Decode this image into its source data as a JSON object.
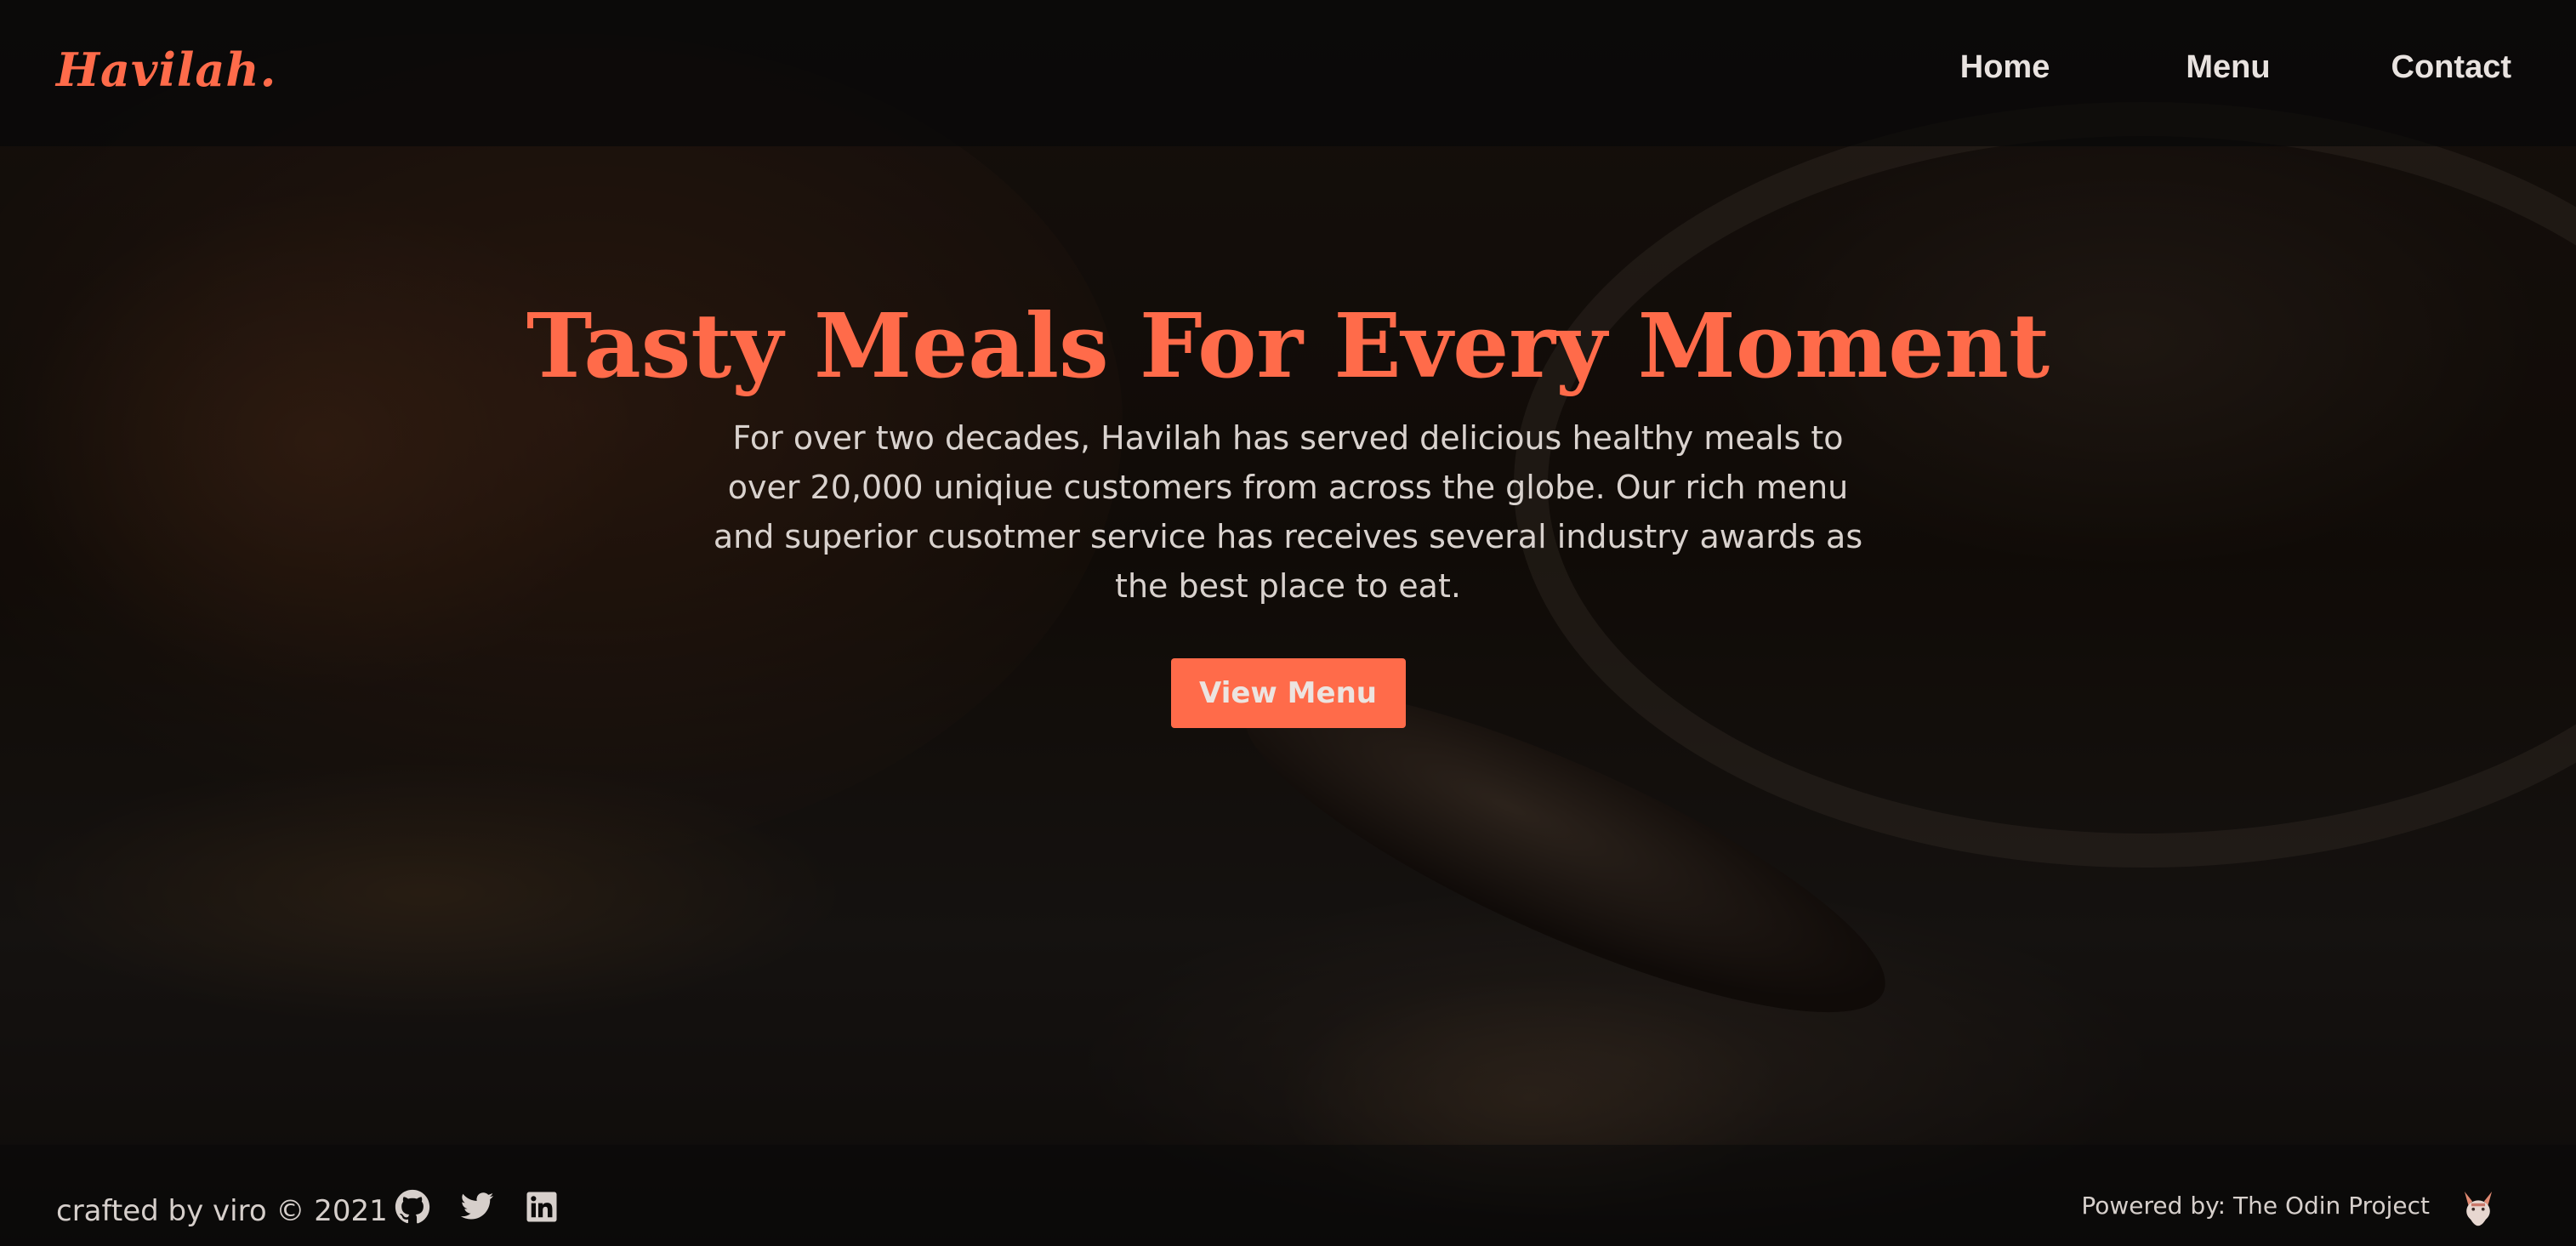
{
  "header": {
    "logo": "Havilah.",
    "nav": [
      {
        "label": "Home"
      },
      {
        "label": "Menu"
      },
      {
        "label": "Contact"
      }
    ]
  },
  "hero": {
    "title": "Tasty Meals For Every Moment",
    "description": "For over two decades, Havilah has served delicious healthy meals to over 20,000 uniqiue customers from across the globe. Our rich menu and superior cusotmer service has receives several industry awards as the best place to eat.",
    "button_label": "View Menu"
  },
  "footer": {
    "credit": "crafted by viro © 2021",
    "socials": [
      {
        "icon": "github-icon"
      },
      {
        "icon": "twitter-icon"
      },
      {
        "icon": "linkedin-icon"
      }
    ],
    "powered_by": "Powered by: The Odin Project",
    "powered_icon": "odin-project-icon"
  },
  "colors": {
    "accent": "#ff6b4a",
    "nav_text": "#e9e3e0",
    "body_text": "#d9d2ce"
  }
}
